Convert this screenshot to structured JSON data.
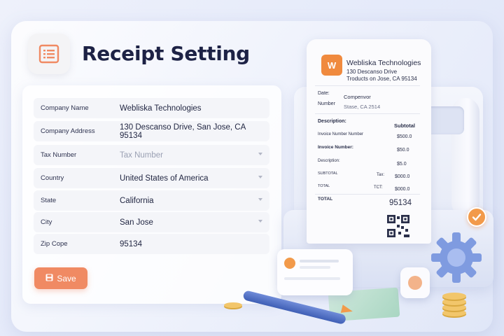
{
  "page": {
    "title": "Receipt Setting"
  },
  "form": {
    "fields": [
      {
        "label": "Company Name",
        "value": "Webliska Technologies",
        "dropdown": false,
        "placeholder": false
      },
      {
        "label": "Company Address",
        "value": "130 Descanso Drive, San Jose, CA 95134",
        "dropdown": false,
        "placeholder": false
      },
      {
        "label": "Tax Number",
        "value": "Tax Number",
        "dropdown": true,
        "placeholder": true
      },
      {
        "label": "Country",
        "value": "United States of America",
        "dropdown": true,
        "placeholder": false
      },
      {
        "label": "State",
        "value": "California",
        "dropdown": true,
        "placeholder": false
      },
      {
        "label": "City",
        "value": "San Jose",
        "dropdown": true,
        "placeholder": false
      },
      {
        "label": "Zip Cope",
        "value": "95134",
        "dropdown": false,
        "placeholder": false
      }
    ],
    "save_label": "Save"
  },
  "receipt": {
    "logo_text": "W",
    "company": "Webliska Technologies",
    "address_line1": "130 Descanso Drive",
    "address_line2": "Troducts on Jose, CA 95134",
    "date_label": "Date:",
    "date_value": "Compenvor",
    "number_label": "Number",
    "number_value": "Stase, CA 2514",
    "description_label": "Description:",
    "subtotal_label": "Subtotal",
    "lines": [
      {
        "left": "Invoice Number Number",
        "right": "$500.0"
      },
      {
        "left": "Invoice Number:",
        "right": "$50.0"
      },
      {
        "left": "Description:",
        "right": "$5.0"
      }
    ],
    "subtotal_row": {
      "left": "SUBTOTAL",
      "mid": "Tax:",
      "right": "$000.0"
    },
    "total_row": {
      "left": "TOTAL",
      "mid": "TCT:",
      "right": "$000.0"
    },
    "total_label": "TOTAL",
    "total_value": "95134"
  },
  "colors": {
    "accent": "#f08a63",
    "title": "#1d2245",
    "field_bg": "#f4f5f9"
  },
  "icons": {
    "title_icon": "receipt-list-icon",
    "save_icon": "floppy-disk-icon",
    "gear": "gear-icon",
    "check": "checkmark-icon"
  }
}
